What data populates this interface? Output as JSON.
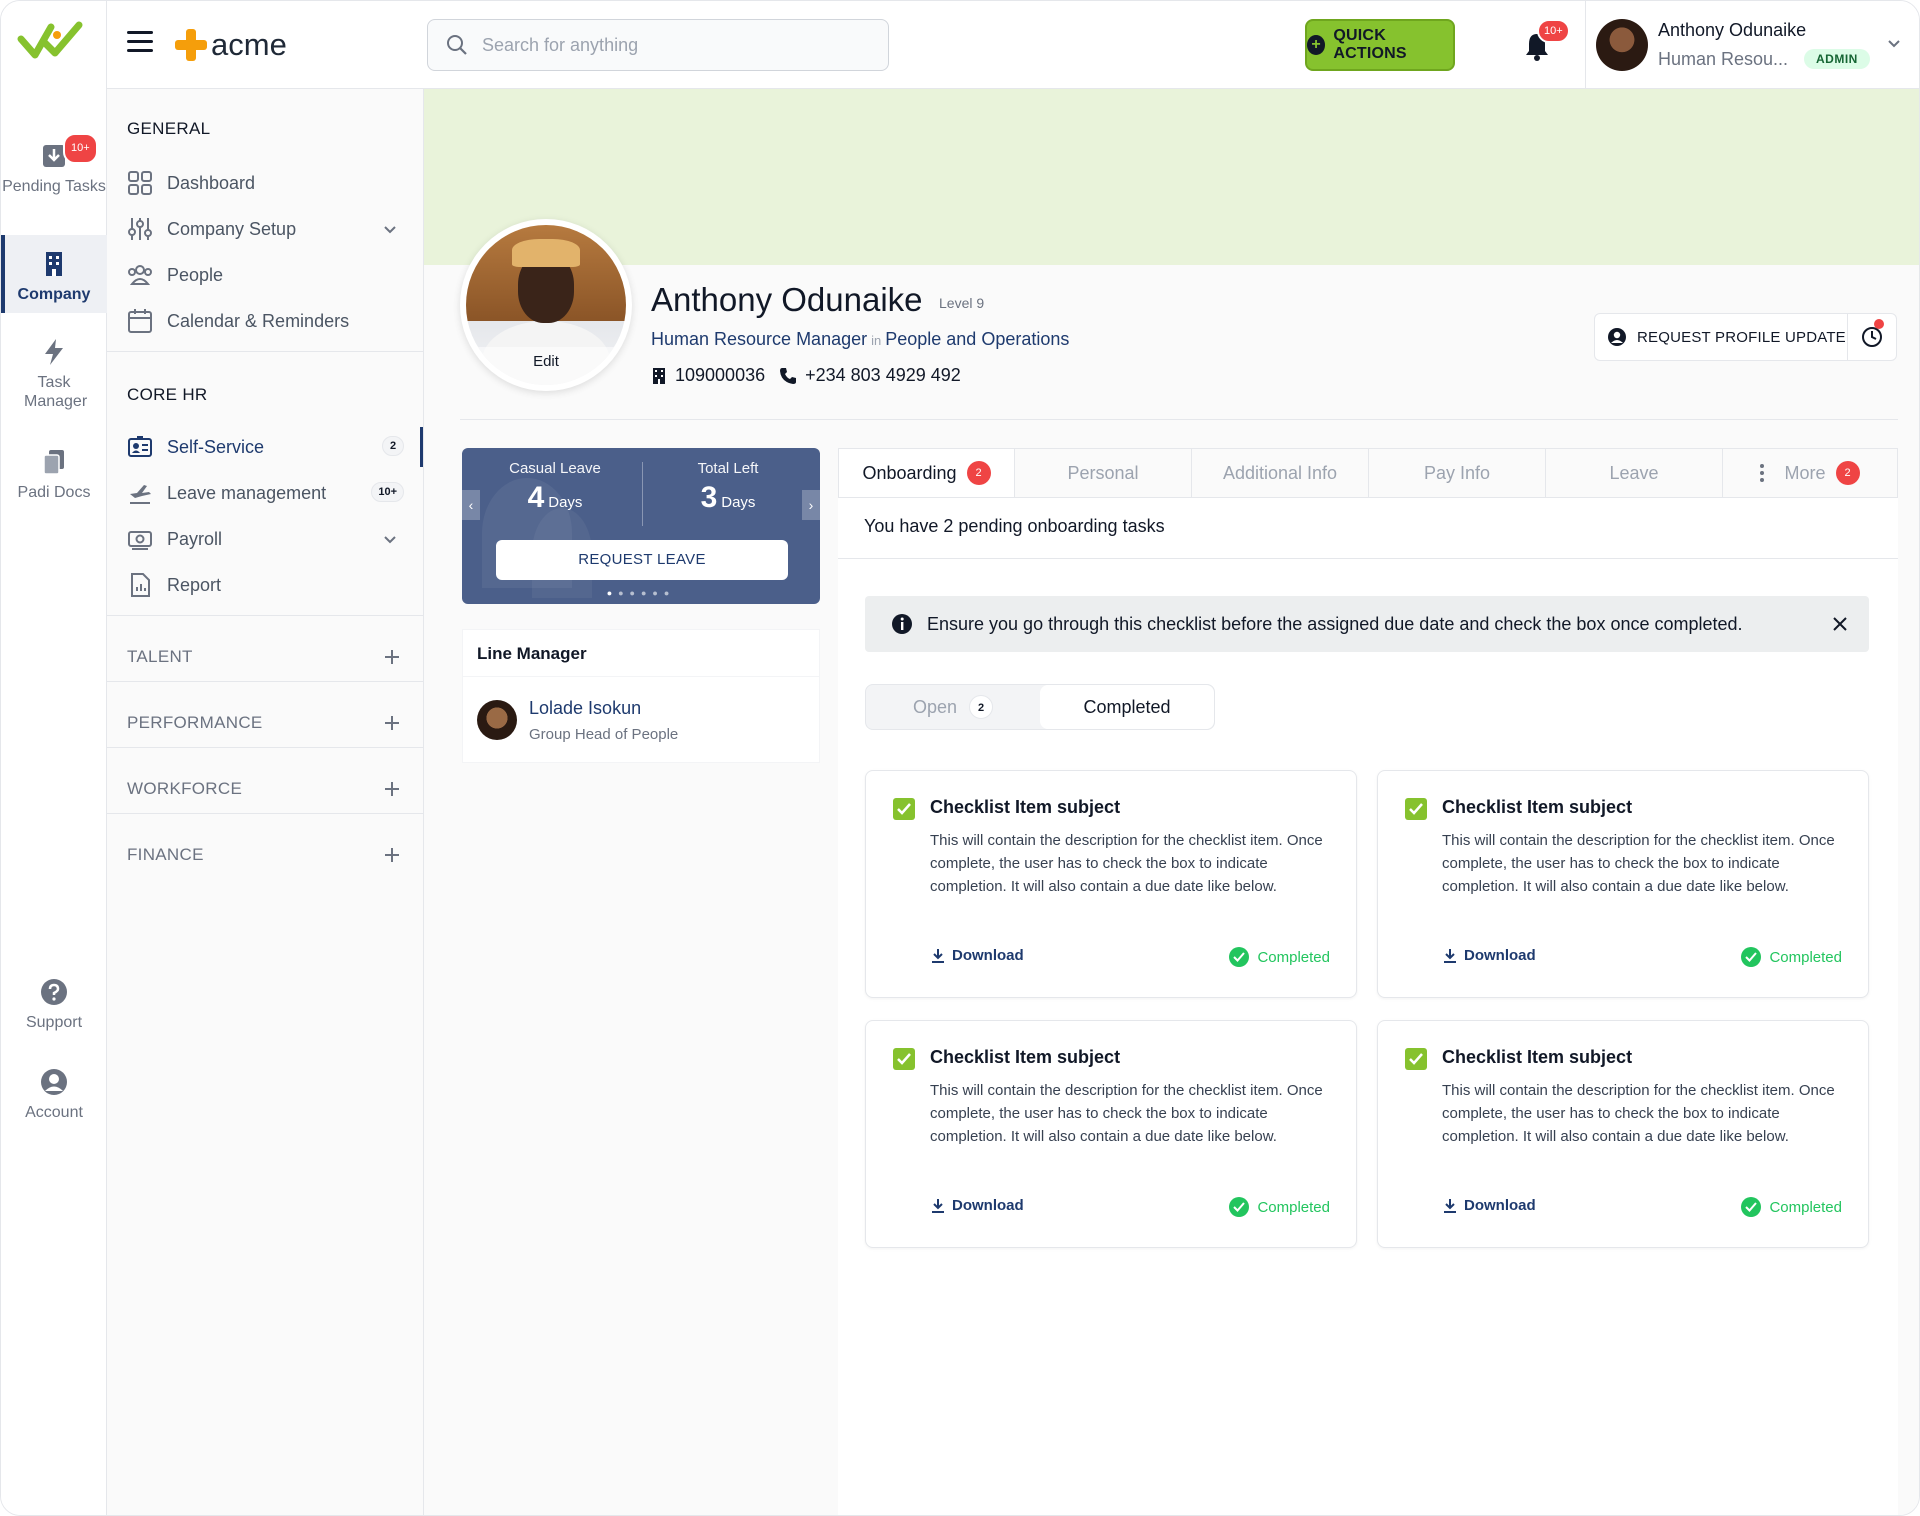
{
  "rail": {
    "items": [
      {
        "label": "Pending Tasks",
        "badge": "10+"
      },
      {
        "label": "Company"
      },
      {
        "label": "Task Manager"
      },
      {
        "label": "Padi Docs"
      },
      {
        "label": "Support"
      },
      {
        "label": "Account"
      }
    ]
  },
  "header": {
    "brand": "acme",
    "search_placeholder": "Search for anything",
    "quick_actions": "QUICK ACTIONS",
    "bell_badge": "10+",
    "user_name": "Anthony Odunaike",
    "user_role": "Human Resou...",
    "user_badge": "ADMIN"
  },
  "sidebar": {
    "general_title": "GENERAL",
    "general": [
      {
        "label": "Dashboard"
      },
      {
        "label": "Company Setup"
      },
      {
        "label": "People"
      },
      {
        "label": "Calendar & Reminders"
      }
    ],
    "core_title": "CORE HR",
    "core": [
      {
        "label": "Self-Service",
        "badge": "2"
      },
      {
        "label": "Leave management",
        "badge": "10+"
      },
      {
        "label": "Payroll"
      },
      {
        "label": "Report"
      }
    ],
    "groups": [
      {
        "label": "TALENT"
      },
      {
        "label": "PERFORMANCE"
      },
      {
        "label": "WORKFORCE"
      },
      {
        "label": "FINANCE"
      }
    ]
  },
  "profile": {
    "edit": "Edit",
    "name": "Anthony Odunaike",
    "level": "Level 9",
    "title": "Human Resource Manager",
    "in": "in",
    "department": "People and Operations",
    "employee_id": "109000036",
    "phone": "+234 803 4929 492",
    "request_update": "REQUEST PROFILE UPDATE"
  },
  "leave": {
    "casual_label": "Casual Leave",
    "casual_value": "4",
    "casual_unit": "Days",
    "left_label": "Total Left",
    "left_value": "3",
    "left_unit": "Days",
    "request": "REQUEST LEAVE"
  },
  "line_manager": {
    "heading": "Line Manager",
    "name": "Lolade Isokun",
    "role": "Group Head of People"
  },
  "tabs": [
    {
      "label": "Onboarding",
      "badge": "2"
    },
    {
      "label": "Personal"
    },
    {
      "label": "Additional Info"
    },
    {
      "label": "Pay Info"
    },
    {
      "label": "Leave"
    },
    {
      "label": "More",
      "badge": "2"
    }
  ],
  "onboarding": {
    "pending": "You have 2 pending onboarding tasks",
    "notice": "Ensure you go through this checklist before the assigned due date and check the box once completed.",
    "seg_open": "Open",
    "seg_open_badge": "2",
    "seg_completed": "Completed",
    "cards": [
      {
        "title": "Checklist Item subject",
        "desc": "This will contain the description for the checklist item. Once complete, the user has to check the box to indicate completion. It will also contain a due date like below.",
        "download": "Download",
        "status": "Completed"
      },
      {
        "title": "Checklist Item subject",
        "desc": "This will contain the description for the checklist item. Once complete, the user has to check the box to indicate completion. It will also contain a due date like below.",
        "download": "Download",
        "status": "Completed"
      },
      {
        "title": "Checklist Item subject",
        "desc": "This will contain the description for the checklist item. Once complete, the user has to check the box to indicate completion. It will also contain a due date like below.",
        "download": "Download",
        "status": "Completed"
      },
      {
        "title": "Checklist Item subject",
        "desc": "This will contain the description for the checklist item. Once complete, the user has to check the box to indicate completion. It will also contain a due date like below.",
        "download": "Download",
        "status": "Completed"
      }
    ]
  },
  "colors": {
    "brand_green": "#86c22e",
    "navy": "#1e3a6e",
    "banner": "#e9f3da",
    "leave_card": "#4b5f8a",
    "badge_red": "#ef4444",
    "status_green": "#22c55e"
  }
}
